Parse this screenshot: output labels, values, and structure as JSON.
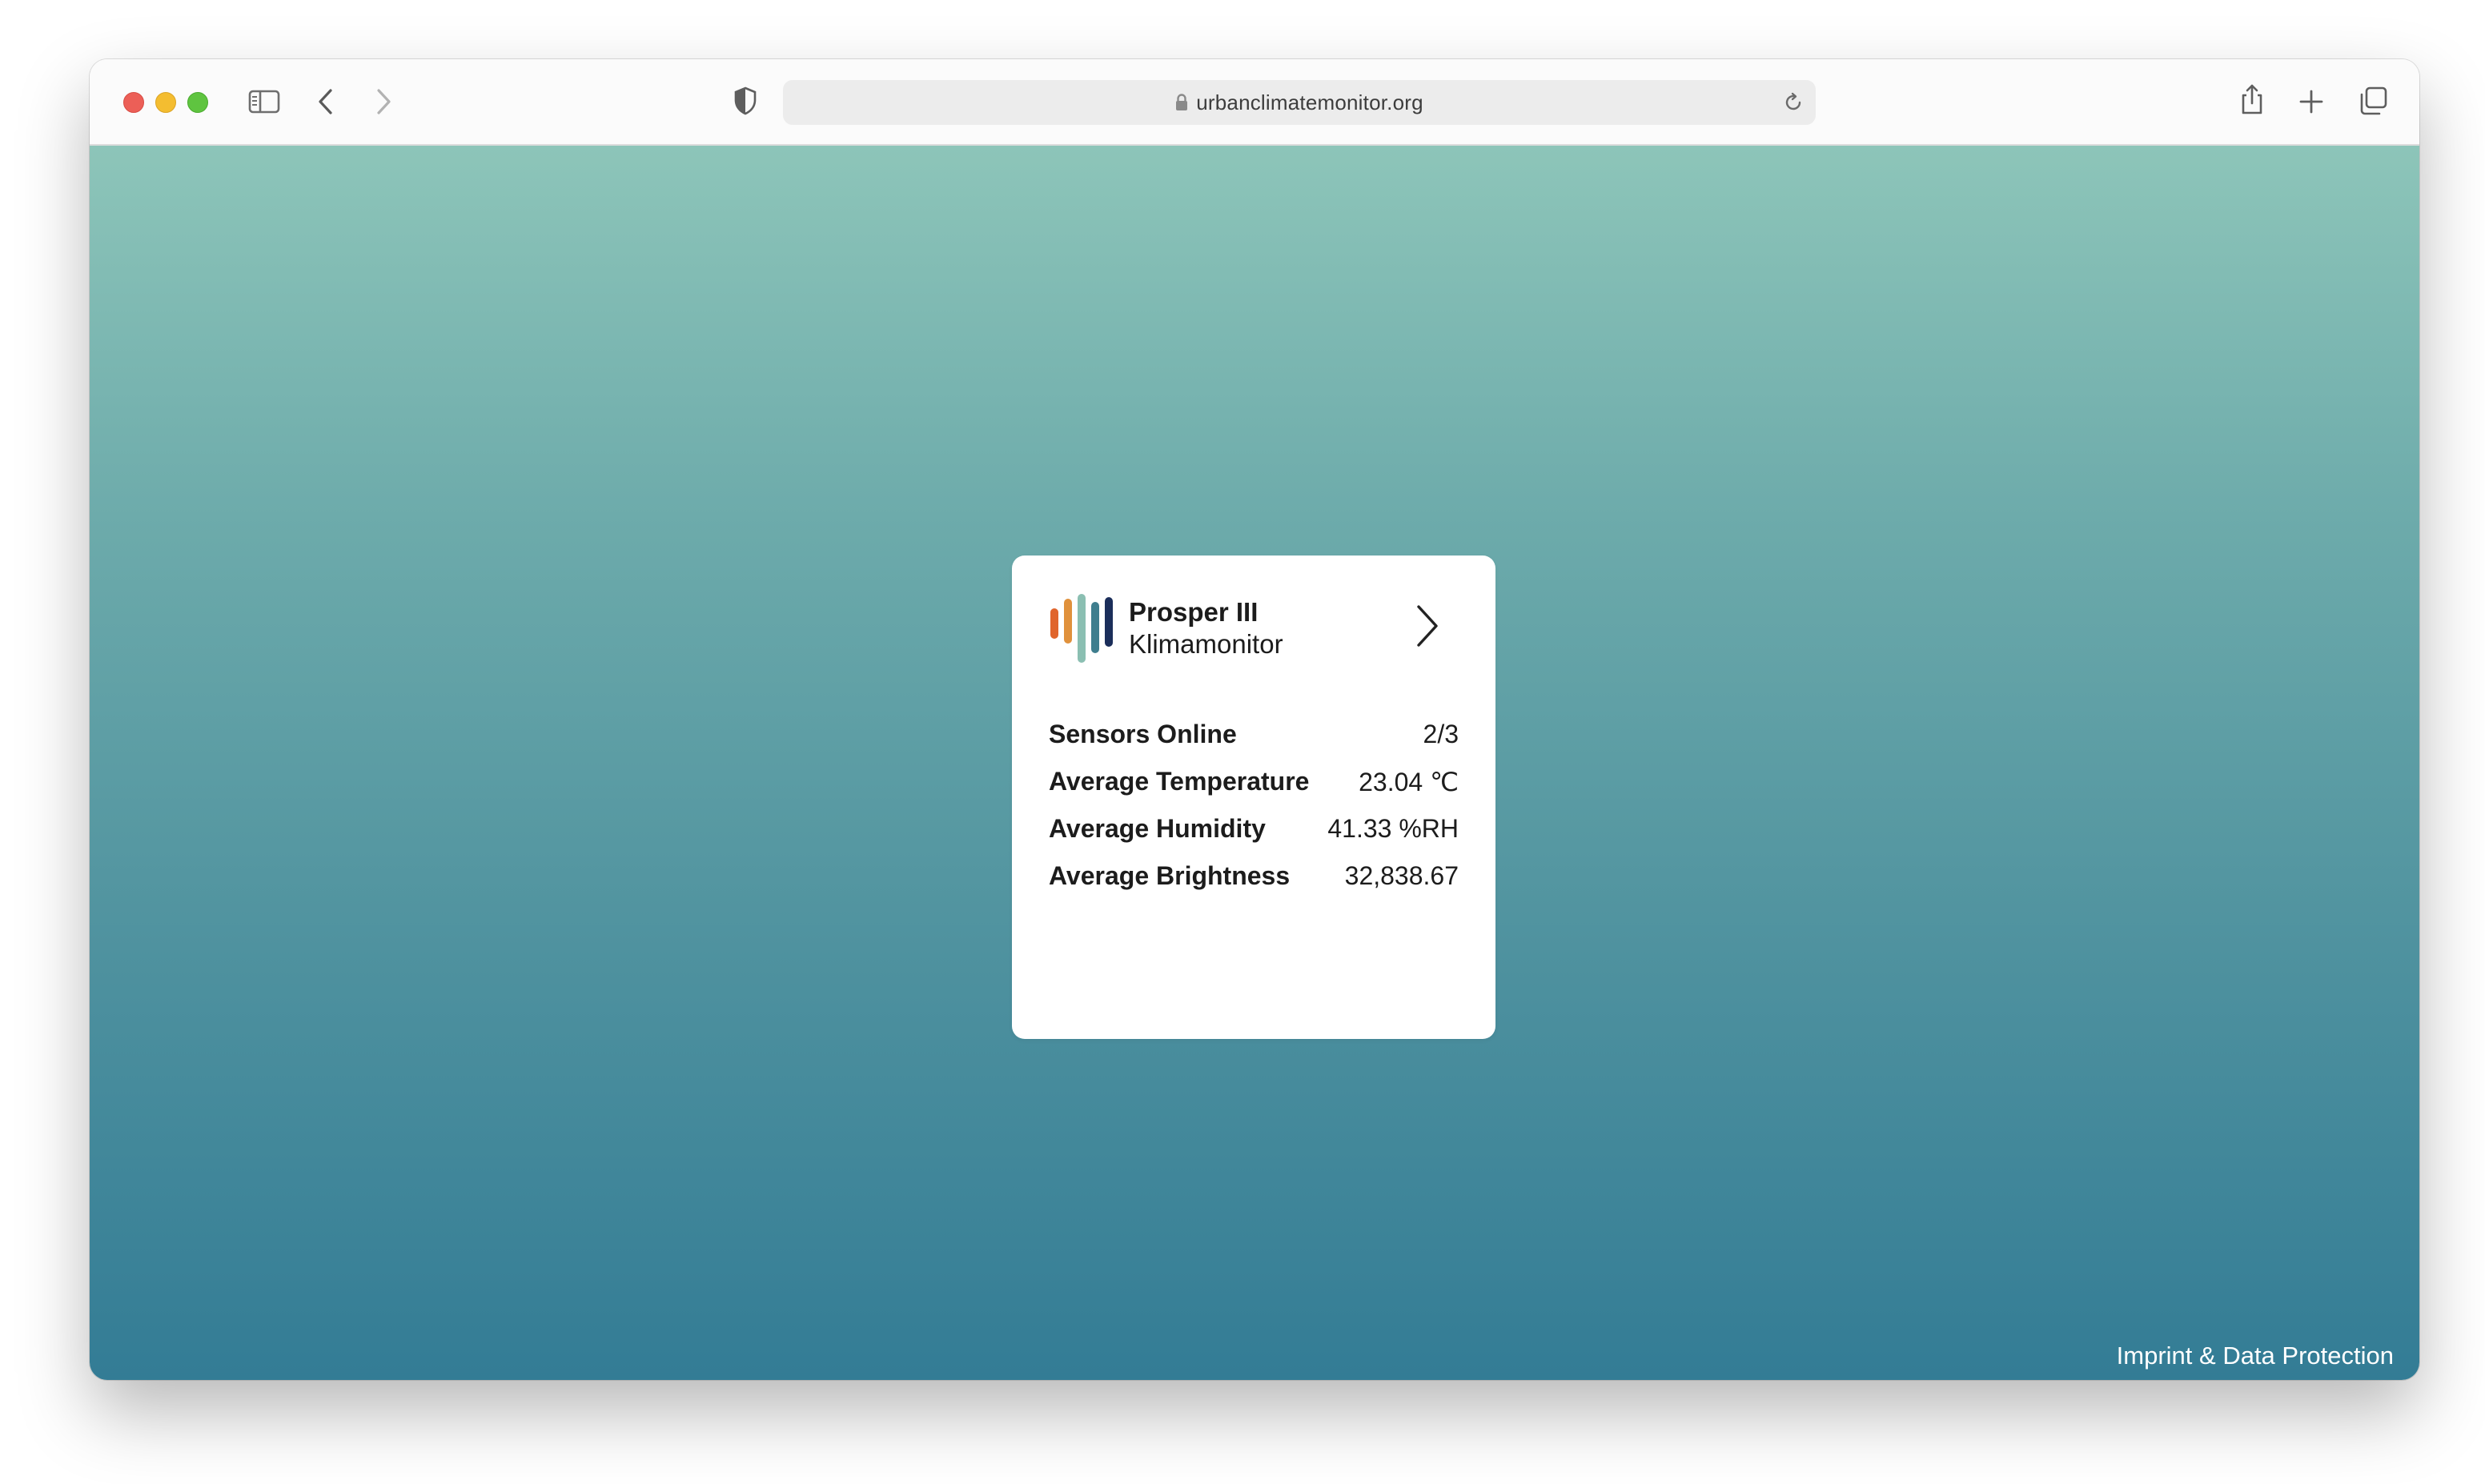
{
  "browser": {
    "url": "urbanclimatemonitor.org"
  },
  "card": {
    "title": "Prosper III",
    "subtitle": "Klimamonitor",
    "logo_colors": [
      "#e0642c",
      "#e0913c",
      "#8bbfb2",
      "#3f7e8e",
      "#1b2e5a"
    ],
    "stats": [
      {
        "label": "Sensors Online",
        "value": "2/3"
      },
      {
        "label": "Average Temperature",
        "value": "23.04 ℃"
      },
      {
        "label": "Average Humidity",
        "value": "41.33 %RH"
      },
      {
        "label": "Average Brightness",
        "value": "32,838.67"
      }
    ]
  },
  "footer": {
    "link": "Imprint & Data Protection"
  }
}
